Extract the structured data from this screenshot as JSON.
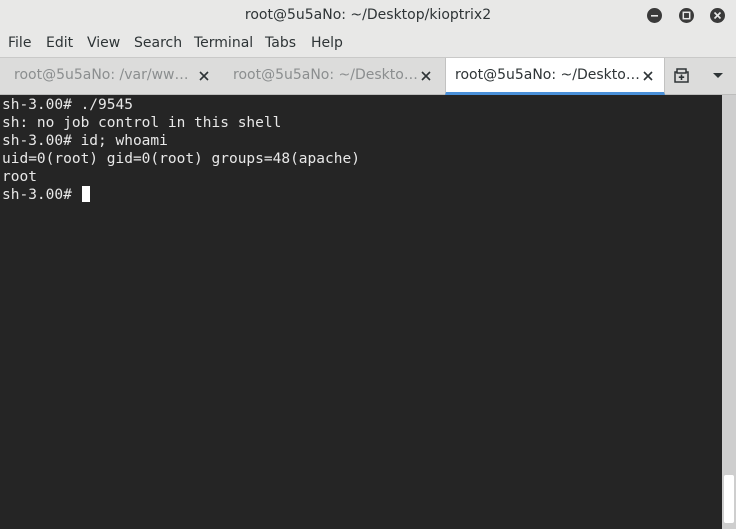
{
  "window": {
    "title": "root@5u5aNo: ~/Desktop/kioptrix2"
  },
  "menu": {
    "items": [
      "File",
      "Edit",
      "View",
      "Search",
      "Terminal",
      "Tabs",
      "Help"
    ]
  },
  "tabs": [
    {
      "label": "root@5u5aNo: /var/ww…",
      "active": false
    },
    {
      "label": "root@5u5aNo: ~/Deskto…",
      "active": false
    },
    {
      "label": "root@5u5aNo: ~/Deskto…",
      "active": true
    }
  ],
  "terminal": {
    "lines": [
      "sh-3.00# ./9545",
      "sh: no job control in this shell",
      "sh-3.00# id; whoami",
      "uid=0(root) gid=0(root) groups=48(apache)",
      "root",
      "sh-3.00# "
    ]
  },
  "colors": {
    "terminal_bg": "#252525",
    "terminal_fg": "#e8e8e8",
    "active_tab_indicator": "#4a90d9"
  },
  "icons": {
    "minimize": "minimize-icon",
    "maximize": "maximize-icon",
    "close": "close-icon",
    "new_tab": "new-tab-icon",
    "tab_menu": "chevron-down-icon"
  }
}
